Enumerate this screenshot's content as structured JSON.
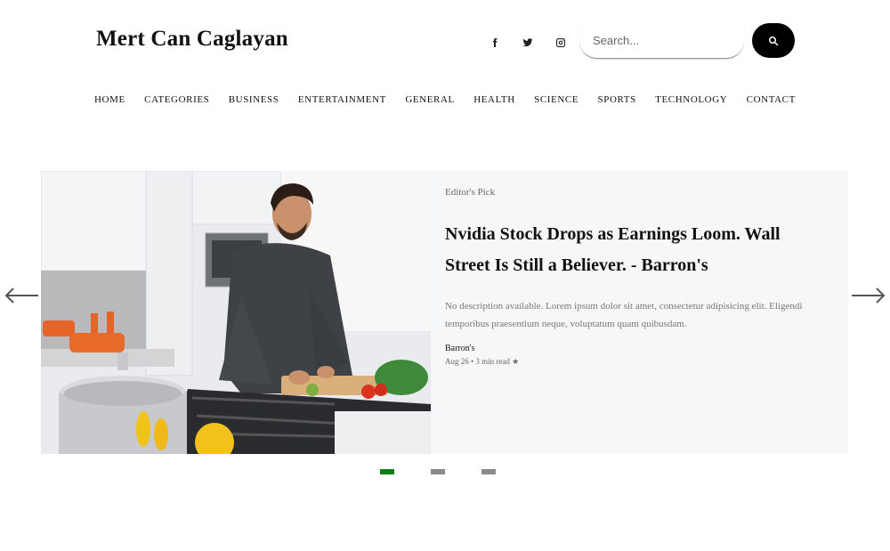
{
  "brand": {
    "title": "Mert Can Caglayan"
  },
  "social": [
    {
      "name": "facebook-icon"
    },
    {
      "name": "twitter-icon"
    },
    {
      "name": "instagram-icon"
    }
  ],
  "search": {
    "placeholder": "Search...",
    "value": ""
  },
  "nav": {
    "items": [
      "HOME",
      "CATEGORIES",
      "BUSINESS",
      "ENTERTAINMENT",
      "GENERAL",
      "HEALTH",
      "SCIENCE",
      "SPORTS",
      "TECHNOLOGY",
      "CONTACT"
    ]
  },
  "featured": {
    "kicker": "Editor's Pick",
    "headline": "Nvidia Stock Drops as Earnings Loom. Wall Street Is Still a Believer. - Barron's",
    "description": "No description available. Lorem ipsum dolor sit amet, consectetur adipisicing elit. Eligendi temporibus praesentium neque, voluptatum quam quibusdam.",
    "source": "Barron's",
    "meta": "Aug 26 • 3 min read ★"
  },
  "carousel": {
    "slides": 3,
    "active_index": 0
  },
  "colors": {
    "active_dot": "#0a7f17",
    "inactive_dot": "#8a8a8a",
    "panel_bg": "#f6f7f9"
  }
}
